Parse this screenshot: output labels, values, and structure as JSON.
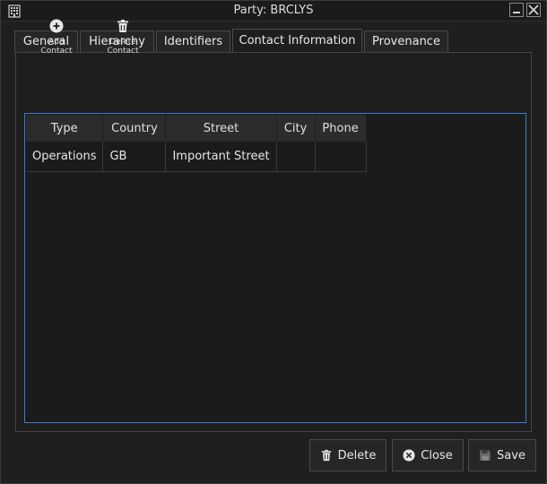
{
  "window": {
    "title": "Party: BRCLYS"
  },
  "tabs": [
    {
      "label": "General",
      "active": false
    },
    {
      "label": "Hierarchy",
      "active": false
    },
    {
      "label": "Identifiers",
      "active": false
    },
    {
      "label": "Contact Information",
      "active": true
    },
    {
      "label": "Provenance",
      "active": false
    }
  ],
  "toolbar": {
    "add_label": "Add Contact",
    "add_icon": "plus-circle-icon",
    "delete_label": "Delete Contact",
    "delete_icon": "trash-icon"
  },
  "table": {
    "columns": [
      "Type",
      "Country",
      "Street",
      "City",
      "Phone"
    ],
    "rows": [
      [
        "Operations",
        "GB",
        "Important Street",
        "",
        ""
      ]
    ]
  },
  "footer": {
    "delete_label": "Delete",
    "close_label": "Close",
    "save_label": "Save"
  },
  "colors": {
    "accent": "#3a7bd5",
    "background": "#1e1e1e"
  }
}
